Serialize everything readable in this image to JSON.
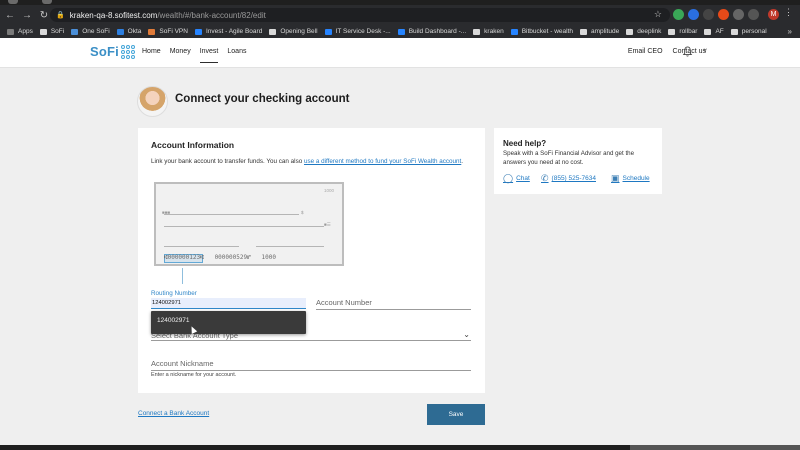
{
  "browser": {
    "url_host": "kraken-qa-8.sofitest.com",
    "url_path": "/wealth/#/bank-account/82/edit",
    "profile_initial": "M",
    "bookmarks": [
      {
        "label": "Apps",
        "color": "#7a7a7a"
      },
      {
        "label": "SoFi",
        "color": "#d9d9d9"
      },
      {
        "label": "One SoFi",
        "color": "#4b8fd8"
      },
      {
        "label": "Okta",
        "color": "#2d7fe0"
      },
      {
        "label": "SoFi VPN",
        "color": "#e07b39"
      },
      {
        "label": "Invest - Agile Board",
        "color": "#2684ff"
      },
      {
        "label": "Opening Bell",
        "color": "#d9d9d9"
      },
      {
        "label": "IT Service Desk -...",
        "color": "#2684ff"
      },
      {
        "label": "Build Dashboard -...",
        "color": "#2684ff"
      },
      {
        "label": "kraken",
        "color": "#d9d9d9"
      },
      {
        "label": "Bitbucket - wealth",
        "color": "#2684ff"
      },
      {
        "label": "amplitude",
        "color": "#d9d9d9"
      },
      {
        "label": "deeplink",
        "color": "#d9d9d9"
      },
      {
        "label": "rollbar",
        "color": "#d9d9d9"
      },
      {
        "label": "AF",
        "color": "#d9d9d9"
      },
      {
        "label": "personal",
        "color": "#d9d9d9"
      }
    ]
  },
  "header": {
    "logo_text": "SoFi",
    "nav": [
      "Home",
      "Money",
      "Invest",
      "Loans"
    ],
    "active_nav": "Invest",
    "email_ceo": "Email CEO",
    "contact_us": "Contact us"
  },
  "page": {
    "title": "Connect your checking account"
  },
  "account_info": {
    "heading": "Account Information",
    "intro_text": "Link your bank account to transfer funds. You can also ",
    "intro_link": "use a different method to fund your SoFi Wealth account",
    "intro_end": ".",
    "check": {
      "number": "1000",
      "micr_routing": "⑆000000123⑆",
      "micr_account": "000000529⑈",
      "micr_check": "1000"
    },
    "routing_label": "Routing Number",
    "routing_value": "124002971",
    "autocomplete_option": "124002971",
    "account_number_placeholder": "Account Number",
    "account_type_placeholder": "Select Bank Account Type",
    "nickname_placeholder": "Account Nickname",
    "nickname_help": "Enter a nickname for your account."
  },
  "help": {
    "title": "Need help?",
    "subtitle": "Speak with a SoFi Financial Advisor and get the answers you need at no cost.",
    "chat": "Chat",
    "phone": "(855) 525-7634",
    "schedule": "Schedule"
  },
  "actions": {
    "connect_link": "Connect a Bank Account",
    "save": "Save"
  },
  "colors": {
    "brand_blue": "#3b8fc6",
    "link_blue": "#1e78c2",
    "save_button": "#2e6b93"
  }
}
